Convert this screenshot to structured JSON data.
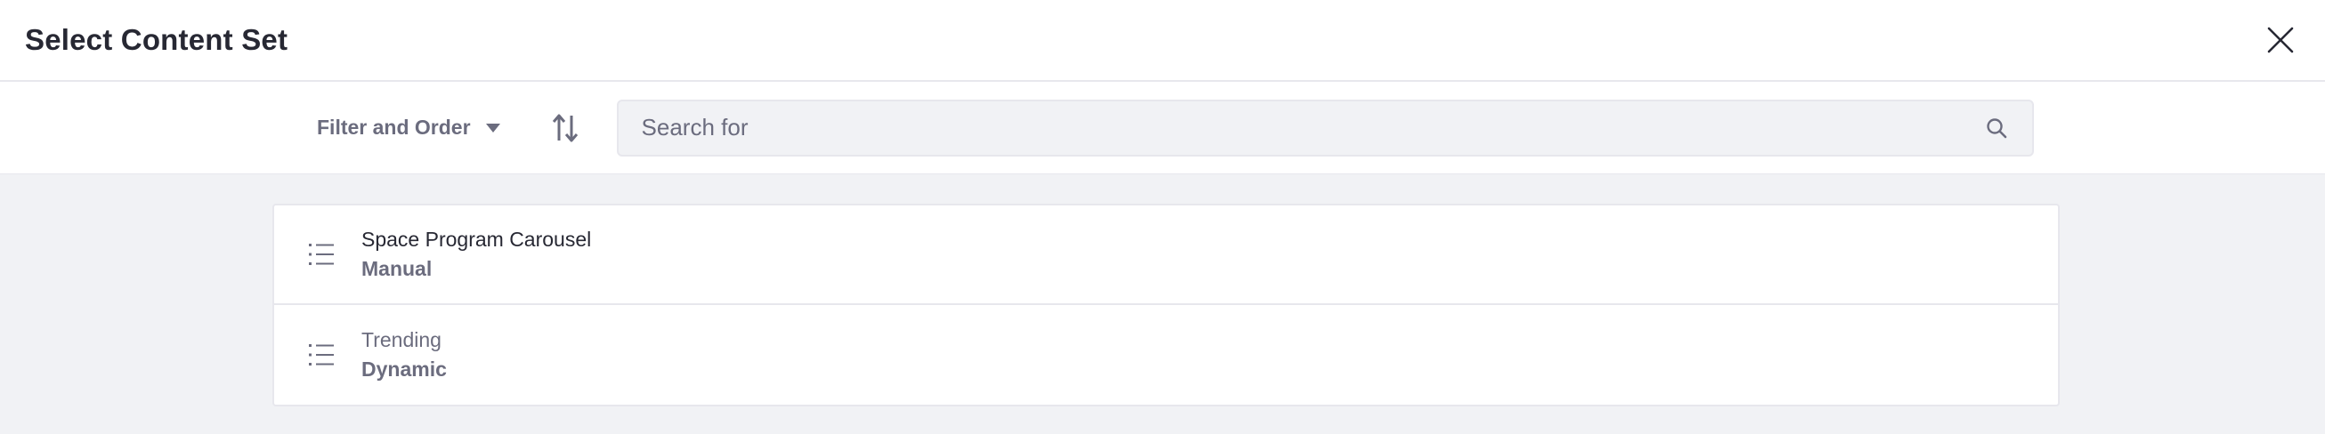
{
  "header": {
    "title": "Select Content Set"
  },
  "toolbar": {
    "filter_label": "Filter and Order",
    "search_placeholder": "Search for"
  },
  "items": [
    {
      "title": "Space Program Carousel",
      "subtitle": "Manual",
      "icon": "list-icon"
    },
    {
      "title": "Trending",
      "subtitle": "Dynamic",
      "icon": "list-icon"
    }
  ],
  "colors": {
    "text_primary": "#272833",
    "text_secondary": "#6b6c7e",
    "background_content": "#f1f2f5",
    "border": "#e7e7ed"
  }
}
